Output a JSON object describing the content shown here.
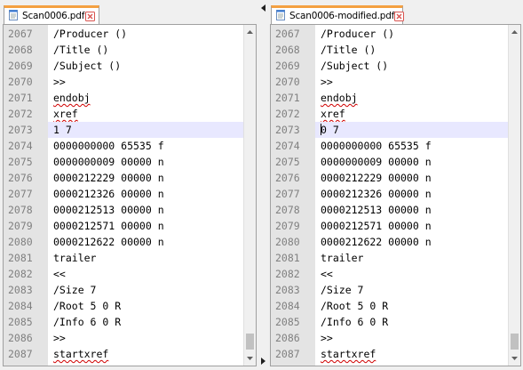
{
  "left": {
    "tab_label": "Scan0006.pdf",
    "lines": [
      {
        "n": "2067",
        "t": "/Producer ()"
      },
      {
        "n": "2068",
        "t": "/Title ()"
      },
      {
        "n": "2069",
        "t": "/Subject ()"
      },
      {
        "n": "2070",
        "t": ">>"
      },
      {
        "n": "2071",
        "t": "endobj"
      },
      {
        "n": "2072",
        "t": "xref"
      },
      {
        "n": "2073",
        "t": "1 7"
      },
      {
        "n": "2074",
        "t": "0000000000 65535 f"
      },
      {
        "n": "2075",
        "t": "0000000009 00000 n"
      },
      {
        "n": "2076",
        "t": "0000212229 00000 n"
      },
      {
        "n": "2077",
        "t": "0000212326 00000 n"
      },
      {
        "n": "2078",
        "t": "0000212513 00000 n"
      },
      {
        "n": "2079",
        "t": "0000212571 00000 n"
      },
      {
        "n": "2080",
        "t": "0000212622 00000 n"
      },
      {
        "n": "2081",
        "t": "trailer"
      },
      {
        "n": "2082",
        "t": "<<"
      },
      {
        "n": "2083",
        "t": "/Size 7"
      },
      {
        "n": "2084",
        "t": "/Root 5 0 R"
      },
      {
        "n": "2085",
        "t": "/Info 6 0 R"
      },
      {
        "n": "2086",
        "t": ">>"
      },
      {
        "n": "2087",
        "t": "startxref"
      }
    ]
  },
  "right": {
    "tab_label": "Scan0006-modified.pdf",
    "lines": [
      {
        "n": "2067",
        "t": "/Producer ()"
      },
      {
        "n": "2068",
        "t": "/Title ()"
      },
      {
        "n": "2069",
        "t": "/Subject ()"
      },
      {
        "n": "2070",
        "t": ">>"
      },
      {
        "n": "2071",
        "t": "endobj"
      },
      {
        "n": "2072",
        "t": "xref"
      },
      {
        "n": "2073",
        "t": "0 7"
      },
      {
        "n": "2074",
        "t": "0000000000 65535 f"
      },
      {
        "n": "2075",
        "t": "0000000009 00000 n"
      },
      {
        "n": "2076",
        "t": "0000212229 00000 n"
      },
      {
        "n": "2077",
        "t": "0000212326 00000 n"
      },
      {
        "n": "2078",
        "t": "0000212513 00000 n"
      },
      {
        "n": "2079",
        "t": "0000212571 00000 n"
      },
      {
        "n": "2080",
        "t": "0000212622 00000 n"
      },
      {
        "n": "2081",
        "t": "trailer"
      },
      {
        "n": "2082",
        "t": "<<"
      },
      {
        "n": "2083",
        "t": "/Size 7"
      },
      {
        "n": "2084",
        "t": "/Root 5 0 R"
      },
      {
        "n": "2085",
        "t": "/Info 6 0 R"
      },
      {
        "n": "2086",
        "t": ">>"
      },
      {
        "n": "2087",
        "t": "startxref"
      }
    ]
  },
  "current_line": "2073",
  "spellcheck_words": [
    "endobj",
    "xref",
    "startxref"
  ],
  "icons": {
    "file_tab": "notepad-file-icon",
    "close": "close-icon",
    "scroll_up": "scroll-up-arrow-icon",
    "scroll_down": "scroll-down-arrow-icon",
    "splitter_left": "splitter-left-arrow-icon",
    "splitter_right": "splitter-right-arrow-icon"
  },
  "colors": {
    "active_tab_accent": "#f4a041",
    "current_line_highlight": "#e8e8ff",
    "gutter_bg": "#e4e4e4",
    "line_number": "#808080",
    "spell_error": "#d00000",
    "close_icon": "#d9534f"
  }
}
